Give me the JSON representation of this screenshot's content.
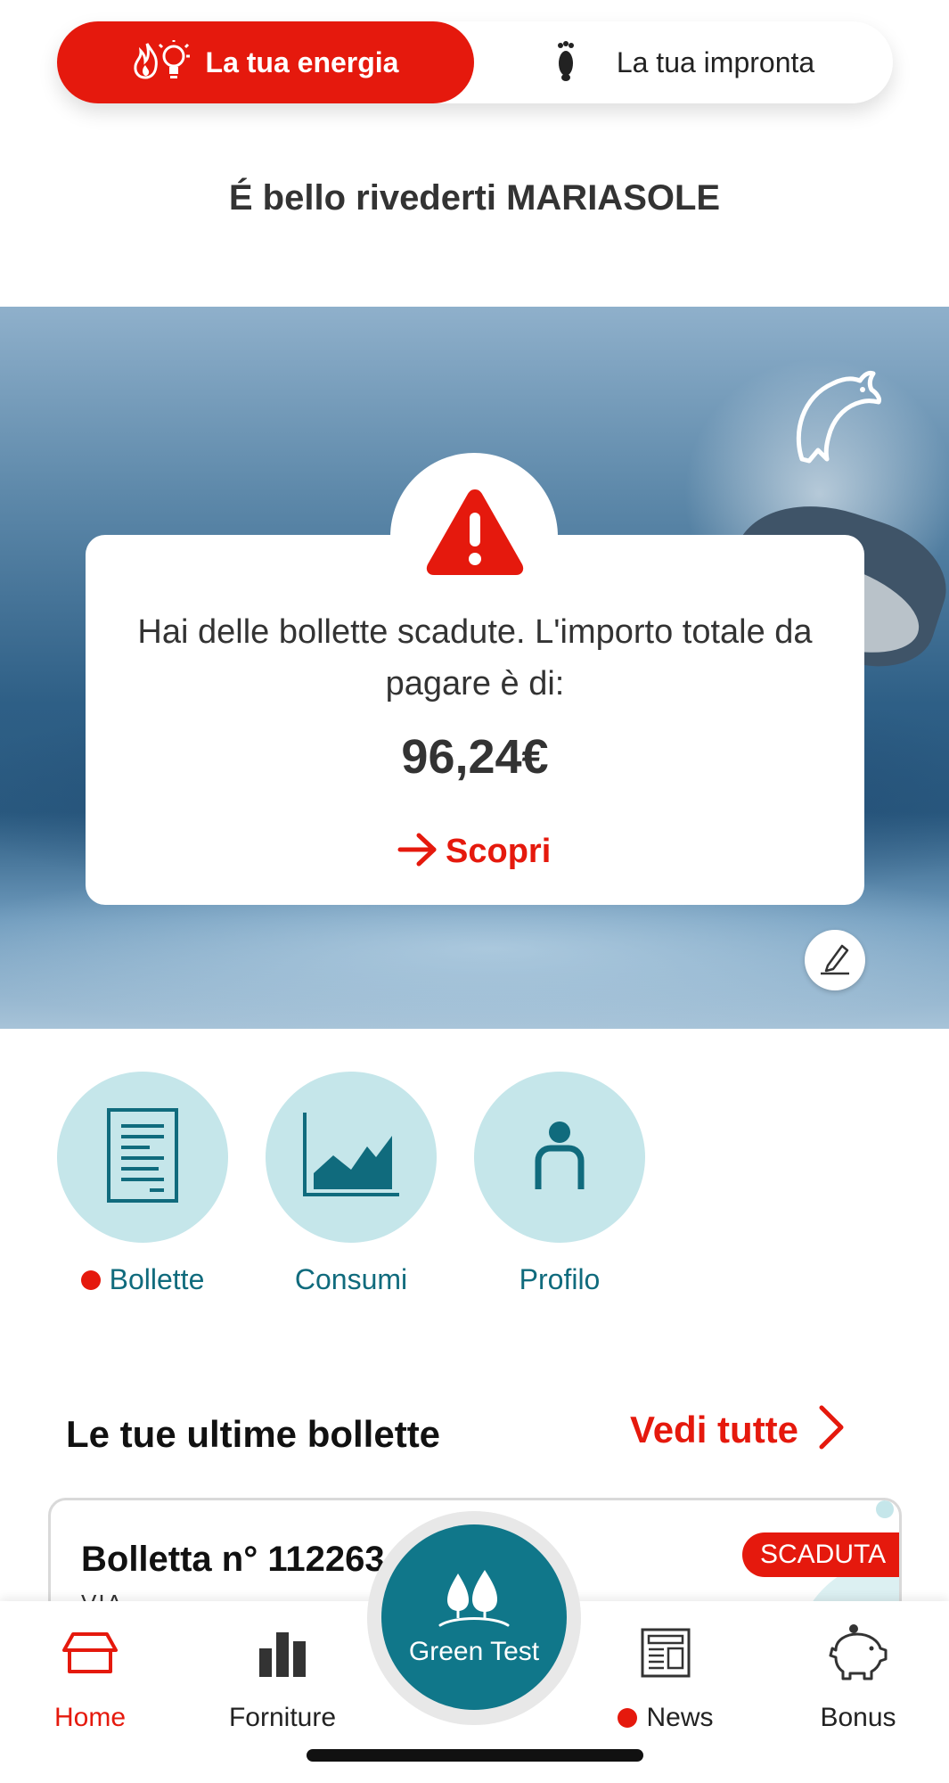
{
  "toggle": {
    "active_label": "La tua energia",
    "inactive_label": "La tua impronta"
  },
  "greeting": "É bello rivederti MARIASOLE",
  "alert": {
    "message": "Hai delle bollette scadute. L'importo totale da pagare è di:",
    "amount": "96,24€",
    "link_label": "Scopri"
  },
  "shortcuts": [
    {
      "label": "Bollette",
      "has_dot": true
    },
    {
      "label": "Consumi",
      "has_dot": false
    },
    {
      "label": "Profilo",
      "has_dot": false
    }
  ],
  "bills_section": {
    "title": "Le tue ultime bollette",
    "see_all": "Vedi tutte"
  },
  "bill": {
    "title": "Bolletta n° 112263",
    "address": "VIA",
    "badge": "SCADUTA"
  },
  "nav": {
    "home": "Home",
    "forniture": "Forniture",
    "green_test": "Green Test",
    "news": "News",
    "bonus": "Bonus"
  },
  "colors": {
    "accent": "#e5190d",
    "teal": "#10778a",
    "light_teal": "#c5e6ea"
  }
}
